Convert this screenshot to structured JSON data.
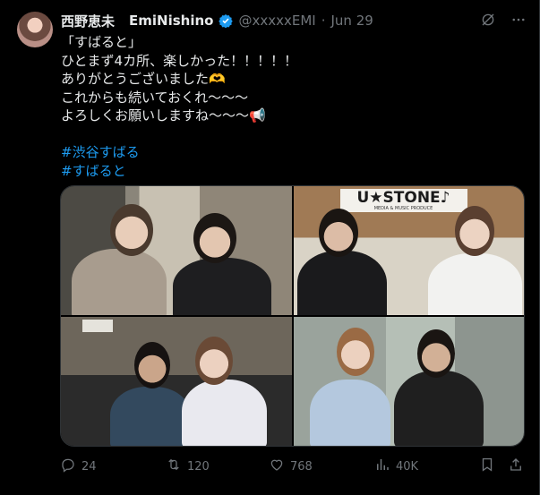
{
  "author": {
    "display_name": "西野恵未",
    "latin_name": "EmiNishino",
    "handle": "@xxxxxEMI",
    "separator": "·",
    "date": "Jun 29"
  },
  "tweet": {
    "lines": [
      "「すばると」",
      "ひとまず4カ所、楽しかった！！！！！",
      "ありがとうございました🫶",
      "これからも続いておくれ〜〜〜",
      "よろしくお願いしますね〜〜〜📢"
    ],
    "hashtags": [
      "#渋谷すばる",
      "#すばると"
    ]
  },
  "media": {
    "sign_text": "U★STONE♪",
    "sign_sub": "MEDIA & MUSIC PRODUCE"
  },
  "actions": {
    "replies": "24",
    "reposts": "120",
    "likes": "768",
    "views": "40K"
  },
  "colors": {
    "background": "#000000",
    "text": "#e7e9ea",
    "muted": "#71767b",
    "link": "#1d9bf0",
    "verified": "#1d9bf0"
  },
  "icons": {
    "top": [
      "grok-icon",
      "more-icon"
    ],
    "actions": [
      "reply-icon",
      "repost-icon",
      "like-icon",
      "views-icon",
      "bookmark-icon",
      "share-icon"
    ]
  }
}
